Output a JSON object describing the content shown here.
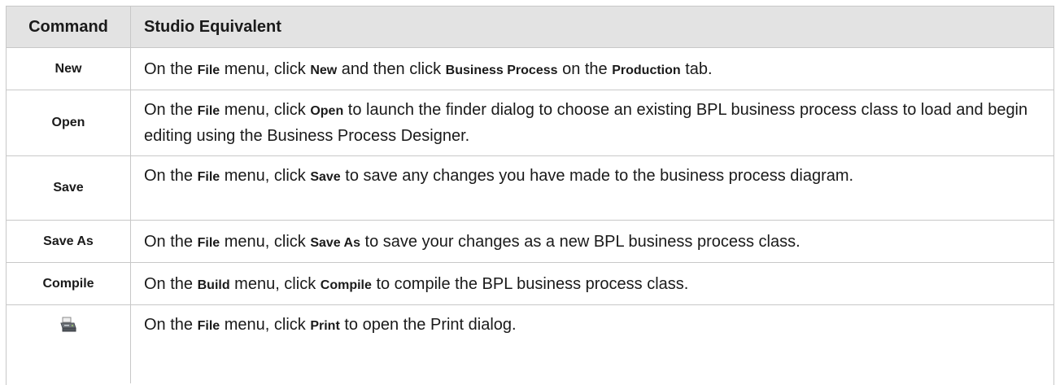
{
  "header": {
    "command": "Command",
    "equivalent": "Studio Equivalent"
  },
  "rows": [
    {
      "command": "New",
      "desc": [
        "On the ",
        "File",
        " menu, click ",
        "New",
        " and then click ",
        "Business Process",
        " on the ",
        "Production",
        " tab."
      ]
    },
    {
      "command": "Open",
      "desc": [
        "On the ",
        "File",
        " menu, click ",
        "Open",
        " to launch the finder dialog to choose an existing BPL business process class to load and begin editing using the Business Process Designer."
      ]
    },
    {
      "command": "Save",
      "desc": [
        "On the ",
        "File",
        " menu, click ",
        "Save",
        " to save any changes you have made to the business process diagram."
      ]
    },
    {
      "command": "Save As",
      "desc": [
        "On the ",
        "File",
        " menu, click ",
        "Save As",
        " to save your changes as a new BPL business process class."
      ]
    },
    {
      "command": "Compile",
      "desc": [
        "On the ",
        "Build",
        " menu, click ",
        "Compile",
        " to compile the BPL business process class."
      ]
    },
    {
      "command_icon": "print-icon",
      "desc": [
        "On the ",
        "File",
        " menu, click ",
        "Print",
        " to open the Print dialog."
      ]
    }
  ]
}
